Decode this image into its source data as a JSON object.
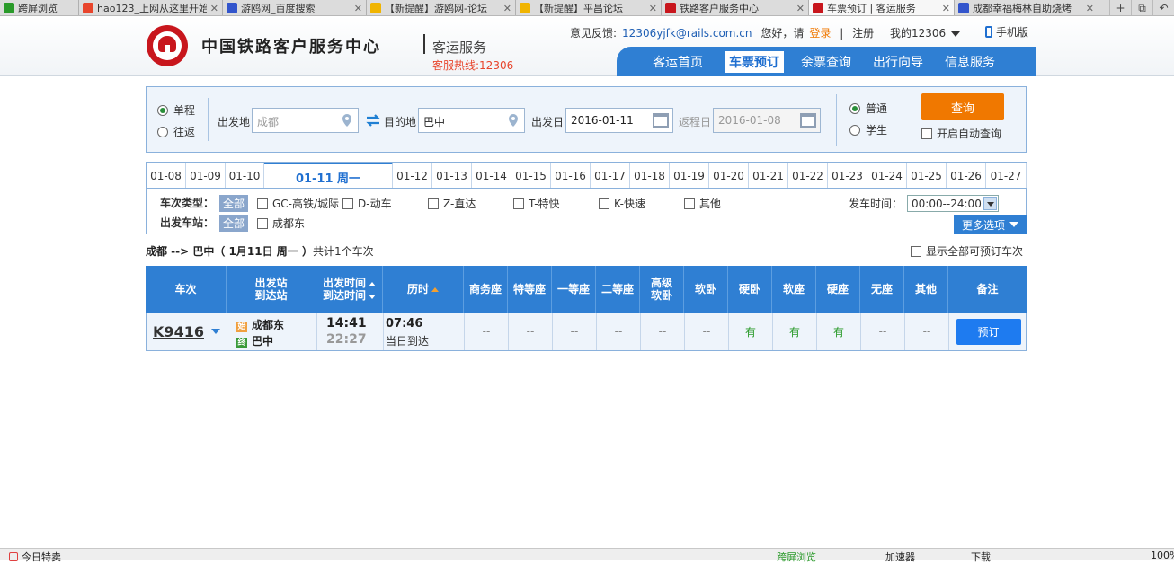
{
  "browser": {
    "tabs": [
      {
        "label": "跨屏浏览",
        "color": "#2a9a2a",
        "w": 88,
        "active": false,
        "close": false
      },
      {
        "label": "hao123_上网从这里开始",
        "color": "#e8452c",
        "w": 160,
        "active": false,
        "close": true
      },
      {
        "label": "游鸥网_百度搜索",
        "color": "#3355cc",
        "w": 160,
        "active": false,
        "close": true
      },
      {
        "label": "【新提醒】游鸥网-论坛",
        "color": "#f0b400",
        "w": 166,
        "active": false,
        "close": true
      },
      {
        "label": "【新提醒】平昌论坛",
        "color": "#f0b400",
        "w": 162,
        "active": false,
        "close": true
      },
      {
        "label": "铁路客户服务中心",
        "color": "#c8161d",
        "w": 164,
        "active": false,
        "close": true
      },
      {
        "label": "车票预订 | 客运服务",
        "color": "#c8161d",
        "w": 162,
        "active": true,
        "close": true
      },
      {
        "label": "成都幸福梅林自助烧烤",
        "color": "#3355cc",
        "w": 160,
        "active": false,
        "close": true
      }
    ],
    "close_glyph": "✕",
    "btn_new": "+",
    "btn_restore": "⧉",
    "btn_undo": "↶",
    "status": {
      "left_text": "今日特卖",
      "cross_screen": "跨屏浏览",
      "accelerator": "加速器",
      "download": "下载",
      "zoom": "100%"
    }
  },
  "header": {
    "site_title": "中国铁路客户服务中心",
    "site_sub": "客运服务",
    "hotline": "客服热线:12306",
    "feedback_label": "意见反馈:",
    "feedback_mail": "12306yjfk@rails.com.cn",
    "greeting": "您好，请",
    "login": "登录",
    "sep": "|",
    "register": "注册",
    "my12306": "我的12306",
    "mobile": "手机版",
    "logo_color": "#c8161d",
    "nav": [
      {
        "label": "客运首页",
        "active": false
      },
      {
        "label": "车票预订",
        "active": true
      },
      {
        "label": "余票查询",
        "active": false
      },
      {
        "label": "出行向导",
        "active": false
      },
      {
        "label": "信息服务",
        "active": false
      }
    ]
  },
  "search": {
    "one_way": "单程",
    "round_trip": "往返",
    "from_label": "出发地",
    "from_placeholder": "成都",
    "to_label": "目的地",
    "to_value": "巴中",
    "depart_label": "出发日",
    "depart_value": "2016-01-11",
    "return_label": "返程日",
    "return_value": "2016-01-08",
    "normal": "普通",
    "student": "学生",
    "query_btn": "查询",
    "auto_query": "开启自动查询",
    "accent": "#f07800"
  },
  "dates": [
    {
      "label": "01-08",
      "w": 44
    },
    {
      "label": "01-09",
      "w": 44
    },
    {
      "label": "01-10",
      "w": 43
    },
    {
      "label": "01-11 周一",
      "w": 143,
      "active": true
    },
    {
      "label": "01-12",
      "w": 44
    },
    {
      "label": "01-13",
      "w": 44
    },
    {
      "label": "01-14",
      "w": 44
    },
    {
      "label": "01-15",
      "w": 44
    },
    {
      "label": "01-16",
      "w": 44
    },
    {
      "label": "01-17",
      "w": 44
    },
    {
      "label": "01-18",
      "w": 44
    },
    {
      "label": "01-19",
      "w": 44
    },
    {
      "label": "01-20",
      "w": 44
    },
    {
      "label": "01-21",
      "w": 44
    },
    {
      "label": "01-22",
      "w": 44
    },
    {
      "label": "01-23",
      "w": 44
    },
    {
      "label": "01-24",
      "w": 44
    },
    {
      "label": "01-25",
      "w": 44
    },
    {
      "label": "01-26",
      "w": 44
    },
    {
      "label": "01-27",
      "w": 45
    }
  ],
  "filter": {
    "train_type_label": "车次类型：",
    "all": "全部",
    "types": [
      "GC-高铁/城际",
      "D-动车",
      "Z-直达",
      "T-特快",
      "K-快速",
      "其他"
    ],
    "station_label": "出发车站：",
    "stations": [
      "成都东"
    ],
    "time_label": "发车时间：",
    "time_value": "00:00--24:00",
    "more": "更多选项"
  },
  "summary": {
    "route": "成都 --> 巴中",
    "date": "（ 1月11日  周一 ）",
    "count": "共计1个车次",
    "show_all": "显示全部可预订车次"
  },
  "table": {
    "headers": [
      "车次",
      "出发站\n到达站",
      "出发时间\n到达时间",
      "历时",
      "商务座",
      "特等座",
      "一等座",
      "二等座",
      "高级\n软卧",
      "软卧",
      "硬卧",
      "软座",
      "硬座",
      "无座",
      "其他",
      "备注"
    ],
    "row": {
      "train_no": "K9416",
      "from_station": "成都东",
      "from_badge": "始",
      "to_station": "巴中",
      "to_badge": "终",
      "depart_time": "14:41",
      "arrive_time": "22:27",
      "duration": "07:46",
      "arrive_day": "当日到达",
      "seats": [
        "--",
        "--",
        "--",
        "--",
        "--",
        "--",
        "有",
        "有",
        "有",
        "--",
        "--"
      ],
      "book": "预订"
    }
  }
}
